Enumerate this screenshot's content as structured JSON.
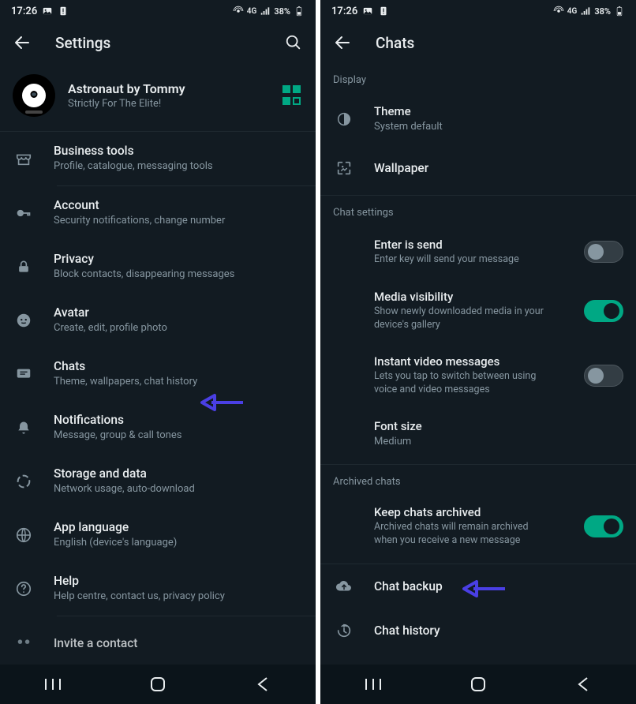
{
  "statusbar": {
    "time": "17:26",
    "battery": "38%",
    "network": "4G"
  },
  "left": {
    "title": "Settings",
    "profile": {
      "name": "Astronaut by Tommy",
      "status": "Strictly For The Elite!"
    },
    "items": [
      {
        "icon": "storefront",
        "title": "Business tools",
        "sub": "Profile, catalogue, messaging tools"
      },
      {
        "icon": "key",
        "title": "Account",
        "sub": "Security notifications, change number"
      },
      {
        "icon": "lock",
        "title": "Privacy",
        "sub": "Block contacts, disappearing messages"
      },
      {
        "icon": "avatar",
        "title": "Avatar",
        "sub": "Create, edit, profile photo"
      },
      {
        "icon": "chat",
        "title": "Chats",
        "sub": "Theme, wallpapers, chat history"
      },
      {
        "icon": "bell",
        "title": "Notifications",
        "sub": "Message, group & call tones"
      },
      {
        "icon": "data",
        "title": "Storage and data",
        "sub": "Network usage, auto-download"
      },
      {
        "icon": "globe",
        "title": "App language",
        "sub": "English (device's language)"
      },
      {
        "icon": "help",
        "title": "Help",
        "sub": "Help centre, contact us, privacy policy"
      },
      {
        "icon": "invite",
        "title": "Invite a contact",
        "sub": ""
      }
    ]
  },
  "right": {
    "title": "Chats",
    "sections": {
      "display": {
        "header": "Display",
        "theme": {
          "title": "Theme",
          "sub": "System default"
        },
        "wallpaper": {
          "title": "Wallpaper"
        }
      },
      "chatsettings": {
        "header": "Chat settings",
        "enter": {
          "title": "Enter is send",
          "sub": "Enter key will send your message",
          "on": false
        },
        "media": {
          "title": "Media visibility",
          "sub": "Show newly downloaded media in your device's gallery",
          "on": true
        },
        "instant": {
          "title": "Instant video messages",
          "sub": "Lets you tap to switch between using voice and video messages",
          "on": false
        },
        "font": {
          "title": "Font size",
          "sub": "Medium"
        }
      },
      "archived": {
        "header": "Archived chats",
        "keep": {
          "title": "Keep chats archived",
          "sub": "Archived chats will remain archived when you receive a new message",
          "on": true
        }
      },
      "backup": {
        "title": "Chat backup"
      },
      "history": {
        "title": "Chat history"
      }
    }
  }
}
